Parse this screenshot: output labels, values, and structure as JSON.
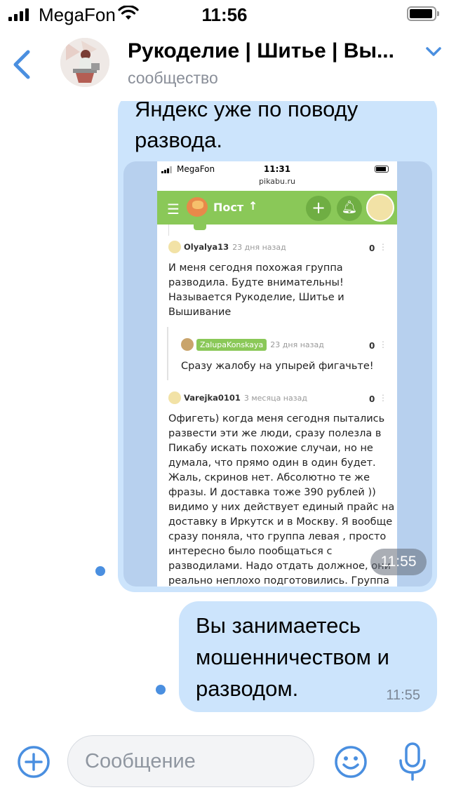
{
  "status_bar": {
    "carrier": "MegaFon",
    "time": "11:56",
    "battery_level": 0.85
  },
  "header": {
    "back_icon": "chevron-left-icon",
    "title": "Рукоделие | Шитье | Вы...",
    "subtitle": "сообщество",
    "dropdown_icon": "chevron-down-icon"
  },
  "messages": [
    {
      "text_lines": [
        "Яндекс уже по поводу",
        "развода."
      ],
      "time": "11:55",
      "attachment": {
        "status_bar": {
          "carrier": "MegaFon",
          "time": "11:31"
        },
        "domain": "pikabu.ru",
        "topbar_title": "Пост",
        "topbar_arrow": "↑",
        "comments": [
          {
            "author": "Olyalya13",
            "ago": "23 дня назад",
            "score": "0",
            "lines": [
              "И меня сегодня похожая группа",
              "разводила. Будте внимательны!",
              "Называется Рукоделие, Шитье и",
              "Вышивание"
            ]
          },
          {
            "author": "ZalupaKonskaya",
            "ago": "23 дня назад",
            "score": "0",
            "lines": [
              "Сразу жалобу на упырей фигачьте!"
            ]
          },
          {
            "author": "Varejka0101",
            "ago": "3 месяца назад",
            "score": "0",
            "lines": [
              "Офигеть) когда меня сегодня пытались",
              "развести эти же люди, сразу полезла в",
              "Пикабу искать похожие случаи, но не",
              "думала, что прямо один в один будет.",
              "Жаль, скринов нет. Абсолютно те же",
              "фразы. И доставка тоже 390 рублей ))",
              "видимо у них действует единый прайс на",
              "доставку в Иркутск и в Москву. Я вообще",
              "сразу поняла, что группа левая , просто",
              "интересно было пообщаться с",
              "разводилами. Надо отдать должное, они",
              "реально неплохо подготовились. Группа"
            ]
          }
        ]
      }
    },
    {
      "text_lines": [
        "Вы занимаетесь",
        "мошенничеством и",
        "разводом."
      ],
      "time": "11:55"
    }
  ],
  "input_bar": {
    "placeholder": "Сообщение",
    "icons": [
      "plus-icon",
      "smile-icon",
      "microphone-icon"
    ]
  },
  "colors": {
    "accent": "#4a8fe0",
    "bubble": "#cce4fc",
    "pikabu_green": "#8ac858"
  }
}
